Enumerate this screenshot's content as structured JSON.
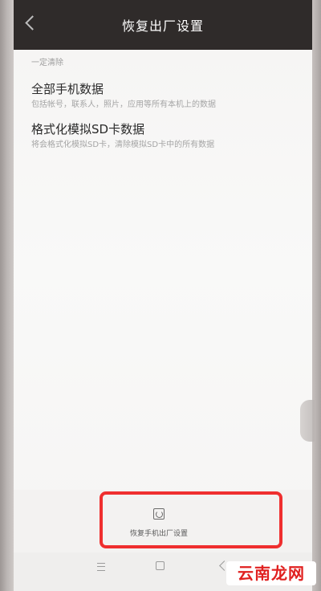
{
  "header": {
    "title": "恢复出厂设置",
    "back_icon": "chevron-left-icon"
  },
  "section": {
    "header": "一定清除",
    "items": [
      {
        "title": "全部手机数据",
        "description": "包括帐号，联系人，照片，应用等所有本机上的数据"
      },
      {
        "title": "格式化模拟SD卡数据",
        "description": "将会格式化模拟SD卡，清除模拟SD卡中的所有数据"
      }
    ]
  },
  "bottom_action": {
    "label": "恢复手机出厂设置",
    "icon": "reset-icon"
  },
  "navbar": {
    "icons": [
      "menu-icon",
      "home-icon",
      "back-icon"
    ]
  },
  "watermark": {
    "text": "云南龙网"
  },
  "colors": {
    "titlebar": "#2f2b2a",
    "highlight": "#ef2f2f",
    "watermark": "#e0201f"
  }
}
